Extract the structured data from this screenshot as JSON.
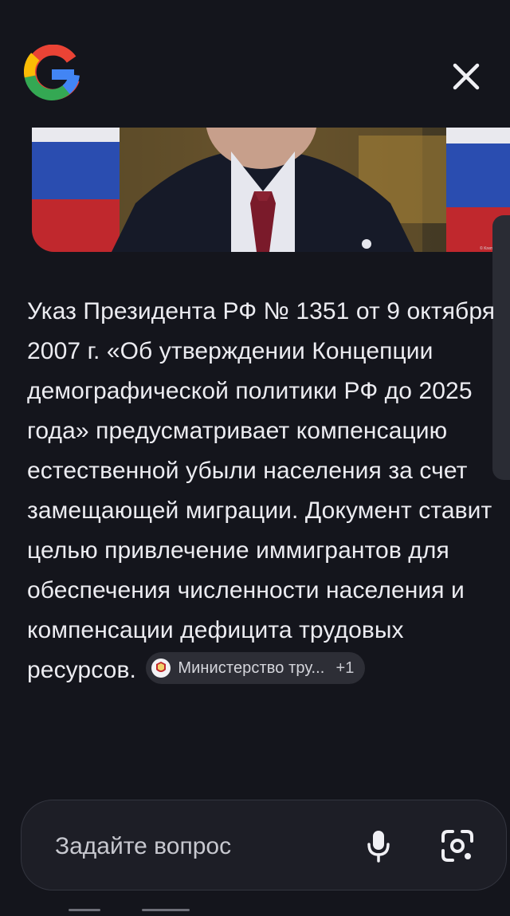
{
  "header": {
    "logo_icon": "google-g-icon",
    "close_icon": "close-icon"
  },
  "hero_image": {
    "description_icon": "photo",
    "credit": "© Kremlin.ru"
  },
  "answer": {
    "text": "Указ Президента РФ № 1351 от 9 октября 2007 г. «Об утверждении Концепции демографической политики РФ до 2025 года» предусматривает компенсацию естественной убыли населения за счет замещающей миграции. Документ ставит целью привлечение иммигрантов для обеспечения численности населения и компенсации дефицита трудовых ресурсов.",
    "source_chip": {
      "label": "Министерство тру...",
      "more": "+1",
      "icon": "ministry-emblem-icon"
    }
  },
  "ask_bar": {
    "placeholder": "Задайте вопрос",
    "mic_icon": "microphone-icon",
    "lens_icon": "camera-lens-icon"
  },
  "colors": {
    "background": "#14151c",
    "text": "#ececf1",
    "chip_bg": "#2d2e36",
    "ask_bar_bg": "#1d1e26"
  }
}
